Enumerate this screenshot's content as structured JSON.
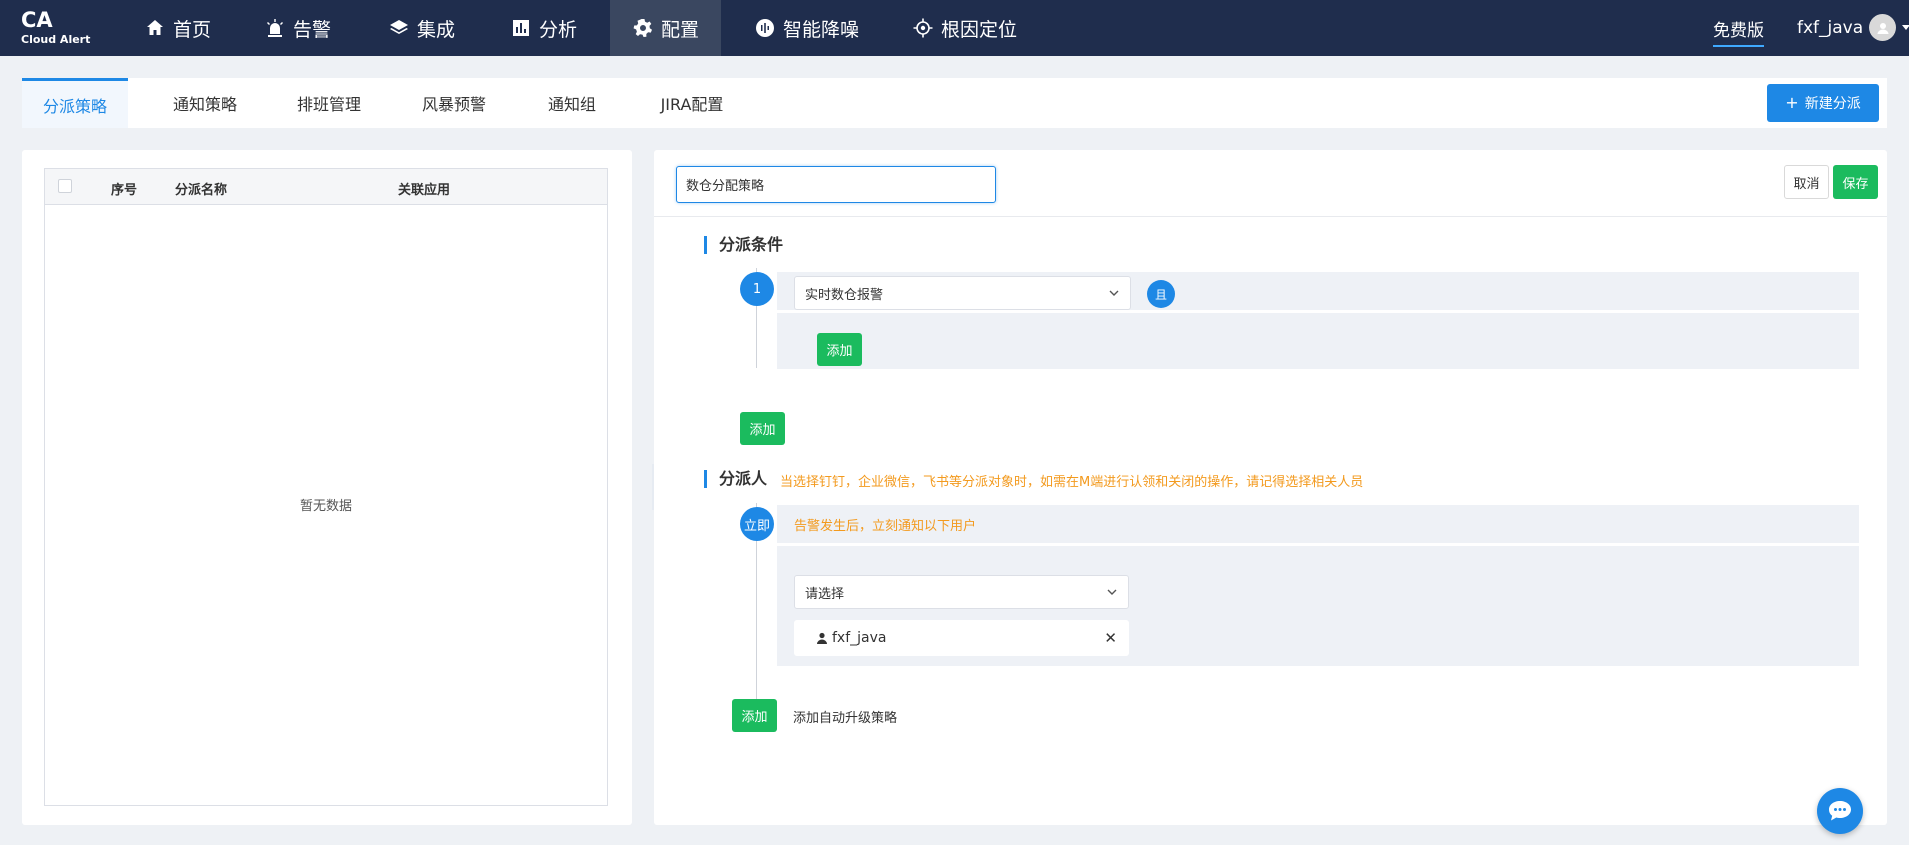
{
  "brand": {
    "logo": "CA",
    "subtitle": "Cloud Alert"
  },
  "topnav": {
    "items": [
      {
        "label": "首页",
        "icon": "home-icon"
      },
      {
        "label": "告警",
        "icon": "siren-icon"
      },
      {
        "label": "集成",
        "icon": "layers-icon"
      },
      {
        "label": "分析",
        "icon": "bar-chart-icon"
      },
      {
        "label": "配置",
        "icon": "gear-icon",
        "active": true
      },
      {
        "label": "智能降噪",
        "icon": "waveform-icon"
      },
      {
        "label": "根因定位",
        "icon": "target-icon"
      }
    ],
    "edition": "免费版",
    "username": "fxf_java"
  },
  "tabs": {
    "items": [
      {
        "label": "分派策略",
        "active": true
      },
      {
        "label": "通知策略"
      },
      {
        "label": "排班管理"
      },
      {
        "label": "风暴预警"
      },
      {
        "label": "通知组"
      },
      {
        "label": "JIRA配置"
      }
    ],
    "new_button": "新建分派"
  },
  "list_table": {
    "columns": [
      "序号",
      "分派名称",
      "关联应用"
    ],
    "empty_text": "暂无数据"
  },
  "editor": {
    "name_value": "数仓分配策略",
    "cancel_label": "取消",
    "save_label": "保存",
    "conditions": {
      "title": "分派条件",
      "step_number": "1",
      "selected_app": "实时数仓报警",
      "and_label": "且",
      "inner_add_label": "添加",
      "outer_add_label": "添加"
    },
    "assignees": {
      "title": "分派人",
      "hint": "当选择钉钉，企业微信，飞书等分派对象时，如需在M端进行认领和关闭的操作，请记得选择相关人员",
      "badge": "立即",
      "subhint": "告警发生后，立刻通知以下用户",
      "select_placeholder": "请选择",
      "selected_user": "fxf_java",
      "add_label": "添加",
      "add_escalation_label": "添加自动升级策略"
    }
  },
  "colors": {
    "nav_bg": "#1f2d4d",
    "primary": "#1e88e5",
    "success": "#1bbb5e",
    "warning_text": "#f39a1e"
  }
}
